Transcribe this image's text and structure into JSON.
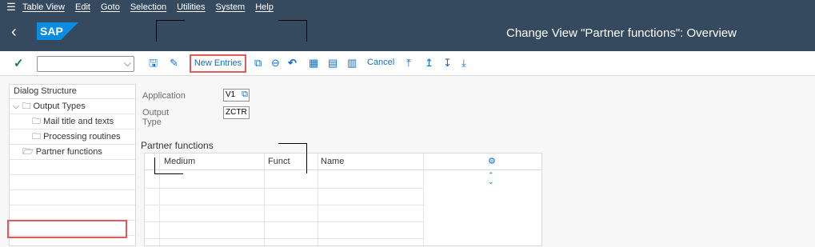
{
  "menu": {
    "items": [
      "Table View",
      "Edit",
      "Goto",
      "Selection",
      "Utilities",
      "System",
      "Help"
    ]
  },
  "header": {
    "title": "Change View \"Partner functions\": Overview",
    "logo_text": "SAP"
  },
  "toolbar": {
    "new_entries_label": "New Entries",
    "cancel_label": "Cancel",
    "command_field_value": ""
  },
  "tree": {
    "header": "Dialog Structure",
    "items": [
      {
        "label": "Output Types",
        "level": 0
      },
      {
        "label": "Mail title and texts",
        "level": 1
      },
      {
        "label": "Processing routines",
        "level": 1
      },
      {
        "label": "Partner functions",
        "level": 1
      }
    ]
  },
  "form": {
    "application_label": "Application",
    "application_value": "V1",
    "output_type_label": "Output Type",
    "output_type_value": "ZCTR"
  },
  "section": {
    "title": "Partner functions"
  },
  "table": {
    "columns": [
      "Medium",
      "Funct",
      "Name"
    ]
  },
  "colors": {
    "shell": "#354a5f",
    "accent": "#0a6ed1",
    "highlight": "#e05a5a"
  }
}
